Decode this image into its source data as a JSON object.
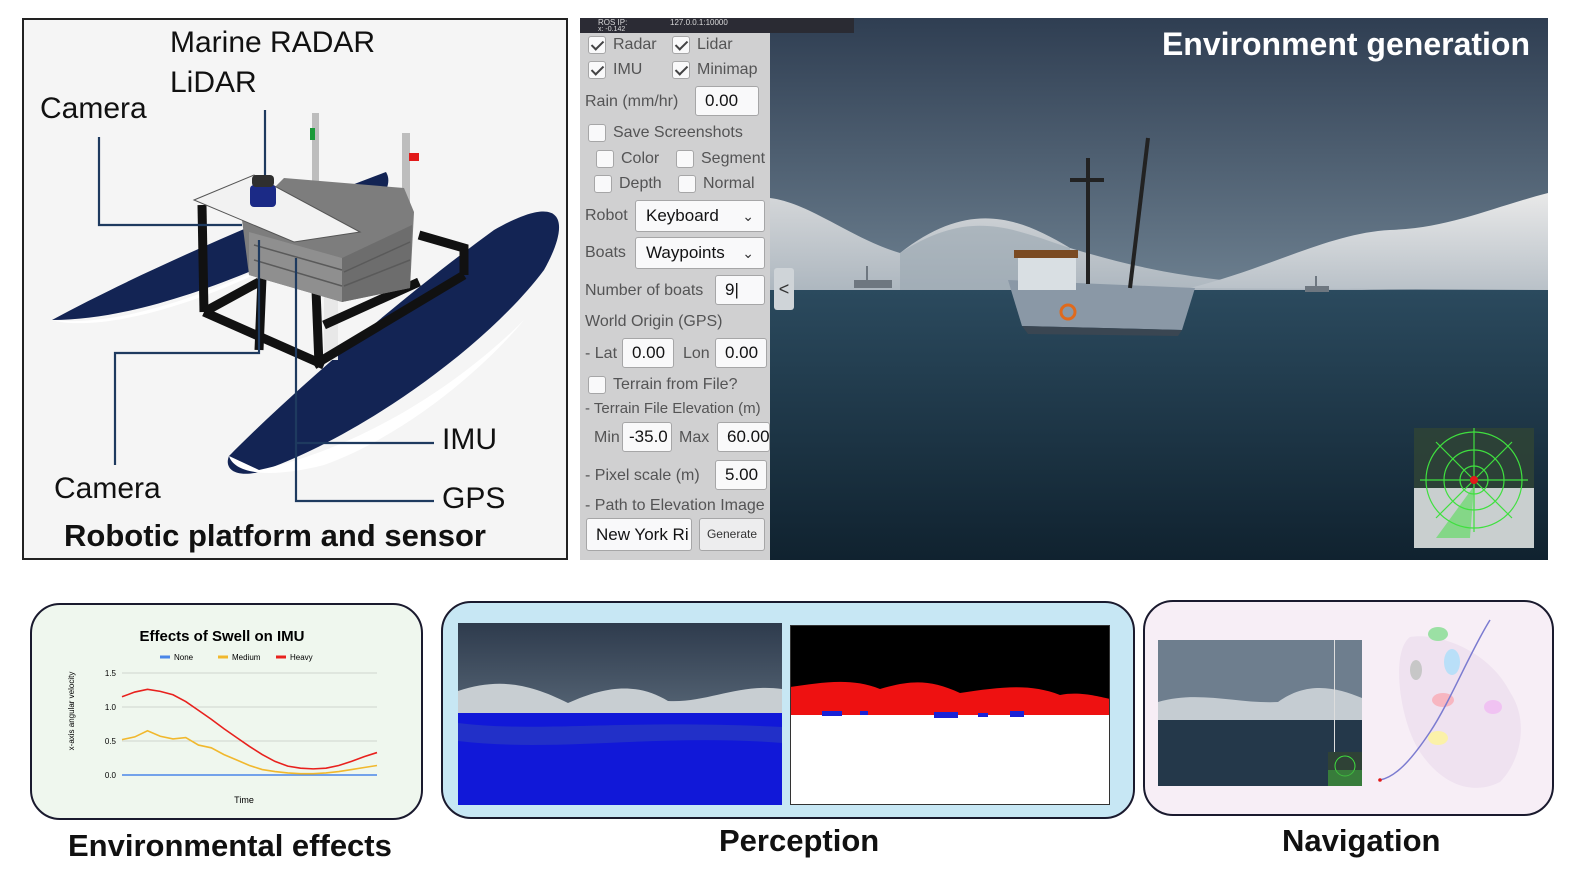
{
  "platform": {
    "labels": {
      "marine_radar": "Marine RADAR",
      "lidar": "LiDAR",
      "camera_top": "Camera",
      "camera_bottom": "Camera",
      "imu": "IMU",
      "gps": "GPS"
    },
    "title": "Robotic platform and sensor"
  },
  "env_generation": {
    "title": "Environment generation",
    "ros_bar": {
      "label": "ROS IP:",
      "value": "127.0.0.1:10000",
      "sub": "x: -0.142"
    },
    "checkboxes": {
      "radar": {
        "label": "Radar",
        "checked": true
      },
      "lidar": {
        "label": "Lidar",
        "checked": true
      },
      "imu": {
        "label": "IMU",
        "checked": true
      },
      "minimap": {
        "label": "Minimap",
        "checked": true
      },
      "save_screenshots": {
        "label": "Save Screenshots",
        "checked": false
      },
      "color": {
        "label": "Color",
        "checked": false
      },
      "segment": {
        "label": "Segment",
        "checked": false
      },
      "depth": {
        "label": "Depth",
        "checked": false
      },
      "normal": {
        "label": "Normal",
        "checked": false
      },
      "terrain_from_file": {
        "label": "Terrain from File?",
        "checked": false
      }
    },
    "rain": {
      "label": "Rain (mm/hr)",
      "value": "0.00"
    },
    "robot": {
      "label": "Robot",
      "selected": "Keyboard"
    },
    "boats": {
      "label": "Boats",
      "selected": "Waypoints"
    },
    "number_of_boats": {
      "label": "Number of boats",
      "value": "9|"
    },
    "world_origin": {
      "label": "World Origin (GPS)",
      "lat_label": "- Lat",
      "lat": "0.00",
      "lon_label": "Lon",
      "lon": "0.00"
    },
    "terrain_elevation": {
      "label": "- Terrain File Elevation (m)",
      "min_label": "Min",
      "min": "-35.0",
      "max_label": "Max",
      "max": "60.00"
    },
    "pixel_scale": {
      "label": "- Pixel scale (m)",
      "value": "5.00"
    },
    "path_to_elevation": {
      "label": "- Path to Elevation Image",
      "value": "New York Ri"
    },
    "generate_button": "Generate",
    "collapse_button": "<"
  },
  "env_effects": {
    "title": "Environmental effects",
    "chart_data": {
      "type": "line",
      "title": "Effects of Swell on IMU",
      "xlabel": "Time",
      "ylabel": "x-axis angular velocity",
      "yticks": [
        "0.0",
        "0.5",
        "1.0",
        "1.5"
      ],
      "ylim": [
        0,
        1.5
      ],
      "legend_position": "top",
      "x": [
        0,
        1,
        2,
        3,
        4,
        5,
        6,
        7,
        8,
        9,
        10,
        11,
        12,
        13,
        14,
        15,
        16,
        17,
        18,
        19,
        20
      ],
      "series": [
        {
          "name": "None",
          "color": "#4a86e8",
          "values": [
            0,
            0,
            0,
            0,
            0,
            0,
            0,
            0,
            0,
            0,
            0,
            0,
            0,
            0,
            0,
            0,
            0,
            0,
            0,
            0,
            0
          ]
        },
        {
          "name": "Medium",
          "color": "#f1b82d",
          "values": [
            0.52,
            0.56,
            0.65,
            0.57,
            0.53,
            0.55,
            0.44,
            0.4,
            0.3,
            0.22,
            0.14,
            0.08,
            0.05,
            0.03,
            0.02,
            0.02,
            0.03,
            0.05,
            0.08,
            0.11,
            0.14
          ]
        },
        {
          "name": "Heavy",
          "color": "#e8211d",
          "values": [
            1.15,
            1.22,
            1.26,
            1.23,
            1.18,
            1.08,
            0.95,
            0.82,
            0.68,
            0.55,
            0.42,
            0.3,
            0.2,
            0.13,
            0.1,
            0.09,
            0.1,
            0.14,
            0.2,
            0.27,
            0.33
          ]
        }
      ]
    }
  },
  "perception": {
    "title": "Perception"
  },
  "navigation": {
    "title": "Navigation"
  }
}
